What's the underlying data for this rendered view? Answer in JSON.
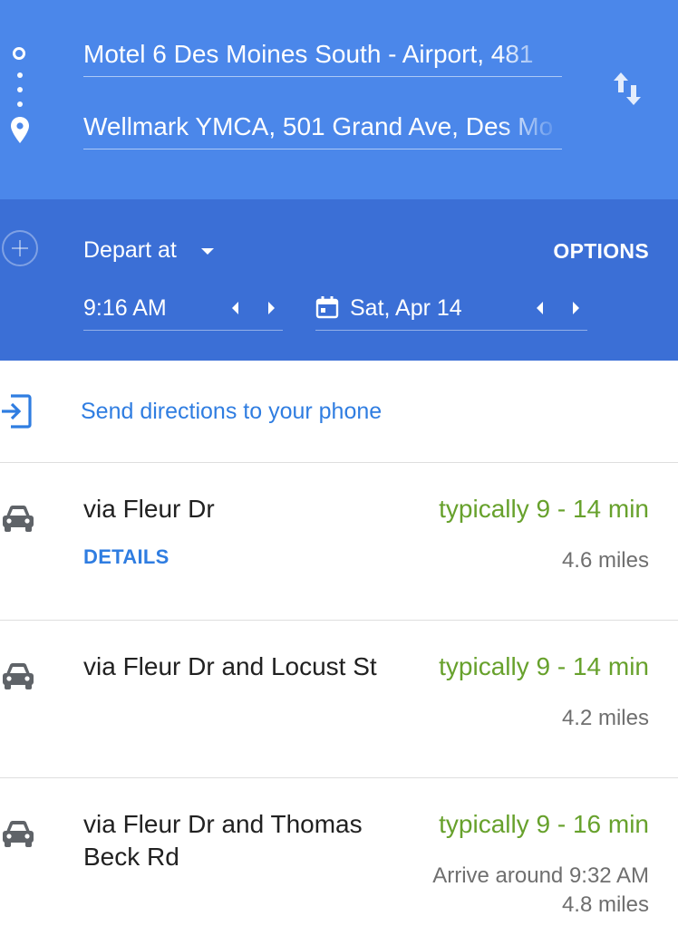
{
  "header": {
    "origin": "Motel 6 Des Moines South - Airport, 481",
    "destination": "Wellmark YMCA, 501 Grand Ave, Des Mo",
    "depart_label": "Depart at",
    "options_label": "OPTIONS",
    "time_value": "9:16 AM",
    "date_value": "Sat, Apr 14"
  },
  "send": {
    "label": "Send directions to your phone"
  },
  "routes": [
    {
      "via": "via Fleur Dr",
      "duration": "typically 9 - 14 min",
      "distance": "4.6 miles",
      "details_label": "DETAILS"
    },
    {
      "via": "via Fleur Dr and Locust St",
      "duration": "typically 9 - 14 min",
      "distance": "4.2 miles"
    },
    {
      "via": "via Fleur Dr and Thomas Beck Rd",
      "duration": "typically 9 - 16 min",
      "arrive": "Arrive around 9:32 AM",
      "distance": "4.8 miles"
    }
  ],
  "colors": {
    "header_top": "#4b87ea",
    "header_bottom": "#3b6fd6",
    "link_blue": "#2f7de1",
    "duration_green": "#67a12c"
  },
  "icons": {
    "origin": "origin-dot-icon",
    "destination": "destination-pin-icon",
    "swap": "swap-arrows-icon",
    "add": "add-destination-icon",
    "calendar": "calendar-icon",
    "send": "send-to-phone-icon",
    "car": "car-icon"
  }
}
